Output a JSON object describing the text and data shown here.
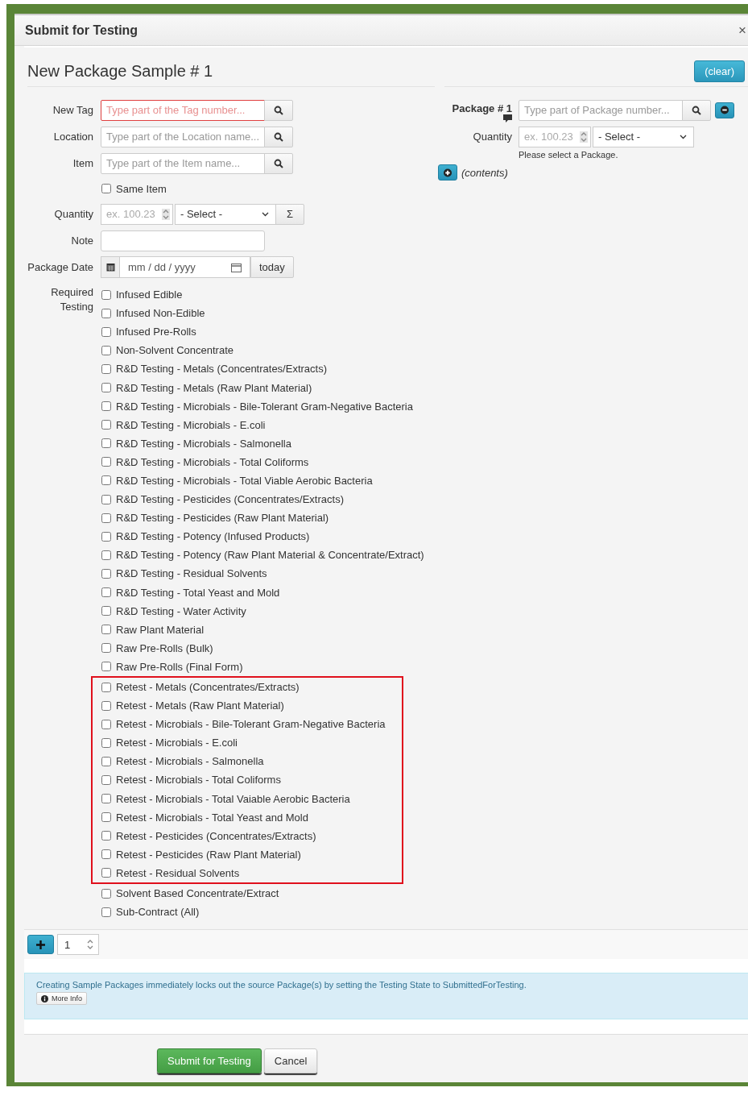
{
  "dialog": {
    "title": "Submit for Testing",
    "close": "×"
  },
  "sample": {
    "heading": "New Package Sample # 1",
    "clear_button": "(clear)"
  },
  "fields": {
    "new_tag": {
      "label": "New Tag",
      "placeholder": "Type part of the Tag number...",
      "invalid": true
    },
    "location": {
      "label": "Location",
      "placeholder": "Type part of the Location name..."
    },
    "item": {
      "label": "Item",
      "placeholder": "Type part of the Item name..."
    },
    "same_item": {
      "label": "Same Item",
      "checked": false
    },
    "quantity": {
      "label": "Quantity",
      "placeholder": "ex. 100.23",
      "unit": "- Select -",
      "sum_button": "Σ"
    },
    "note": {
      "label": "Note"
    },
    "package_date": {
      "label": "Package Date",
      "placeholder": "mm / dd / yyyy",
      "today_button": "today"
    }
  },
  "required_testing": {
    "label": "Required Testing",
    "groups": [
      {
        "highlighted": false,
        "options": [
          {
            "label": "Infused Edible",
            "checked": false
          },
          {
            "label": "Infused Non-Edible",
            "checked": false
          },
          {
            "label": "Infused Pre-Rolls",
            "checked": false
          },
          {
            "label": "Non-Solvent Concentrate",
            "checked": false
          },
          {
            "label": "R&D Testing - Metals (Concentrates/Extracts)",
            "checked": false
          },
          {
            "label": "R&D Testing - Metals (Raw Plant Material)",
            "checked": false
          },
          {
            "label": "R&D Testing - Microbials - Bile-Tolerant Gram-Negative Bacteria",
            "checked": false
          },
          {
            "label": "R&D Testing - Microbials - E.coli",
            "checked": false
          },
          {
            "label": "R&D Testing - Microbials - Salmonella",
            "checked": false
          },
          {
            "label": "R&D Testing - Microbials - Total Coliforms",
            "checked": false
          },
          {
            "label": "R&D Testing - Microbials - Total Viable Aerobic Bacteria",
            "checked": false
          },
          {
            "label": "R&D Testing - Pesticides (Concentrates/Extracts)",
            "checked": false
          },
          {
            "label": "R&D Testing - Pesticides (Raw Plant Material)",
            "checked": false
          },
          {
            "label": "R&D Testing - Potency (Infused Products)",
            "checked": false
          },
          {
            "label": "R&D Testing - Potency (Raw Plant Material & Concentrate/Extract)",
            "checked": false
          },
          {
            "label": "R&D Testing - Residual Solvents",
            "checked": false
          },
          {
            "label": "R&D Testing - Total Yeast and Mold",
            "checked": false
          },
          {
            "label": "R&D Testing - Water Activity",
            "checked": false
          },
          {
            "label": "Raw Plant Material",
            "checked": false
          },
          {
            "label": "Raw Pre-Rolls (Bulk)",
            "checked": false
          },
          {
            "label": "Raw Pre-Rolls (Final Form)",
            "checked": false
          }
        ]
      },
      {
        "highlighted": true,
        "options": [
          {
            "label": "Retest - Metals (Concentrates/Extracts)",
            "checked": false
          },
          {
            "label": "Retest - Metals (Raw Plant Material)",
            "checked": false
          },
          {
            "label": "Retest - Microbials - Bile-Tolerant Gram-Negative Bacteria",
            "checked": false
          },
          {
            "label": "Retest - Microbials - E.coli",
            "checked": false
          },
          {
            "label": "Retest - Microbials - Salmonella",
            "checked": false
          },
          {
            "label": "Retest - Microbials - Total Coliforms",
            "checked": false
          },
          {
            "label": "Retest - Microbials - Total Vaiable Aerobic Bacteria",
            "checked": false
          },
          {
            "label": "Retest - Microbials - Total Yeast and Mold",
            "checked": false
          },
          {
            "label": "Retest - Pesticides (Concentrates/Extracts)",
            "checked": false
          },
          {
            "label": "Retest - Pesticides (Raw Plant Material)",
            "checked": false
          },
          {
            "label": "Retest - Residual Solvents",
            "checked": false
          }
        ]
      },
      {
        "highlighted": false,
        "options": [
          {
            "label": "Solvent Based Concentrate/Extract",
            "checked": false
          },
          {
            "label": "Sub-Contract (All)",
            "checked": false
          }
        ]
      }
    ]
  },
  "package": {
    "label": "Package # 1",
    "placeholder": "Type part of Package number...",
    "quantity_label": "Quantity",
    "quantity_placeholder": "ex. 100.23",
    "unit": "- Select -",
    "hint": "Please select a Package.",
    "contents": "(contents)"
  },
  "add_row": {
    "count": "1"
  },
  "info": {
    "text": "Creating Sample Packages immediately locks out the source Package(s) by setting the Testing State to SubmittedForTesting.",
    "more_info": "More Info"
  },
  "actions": {
    "submit": "Submit for Testing",
    "cancel": "Cancel"
  }
}
